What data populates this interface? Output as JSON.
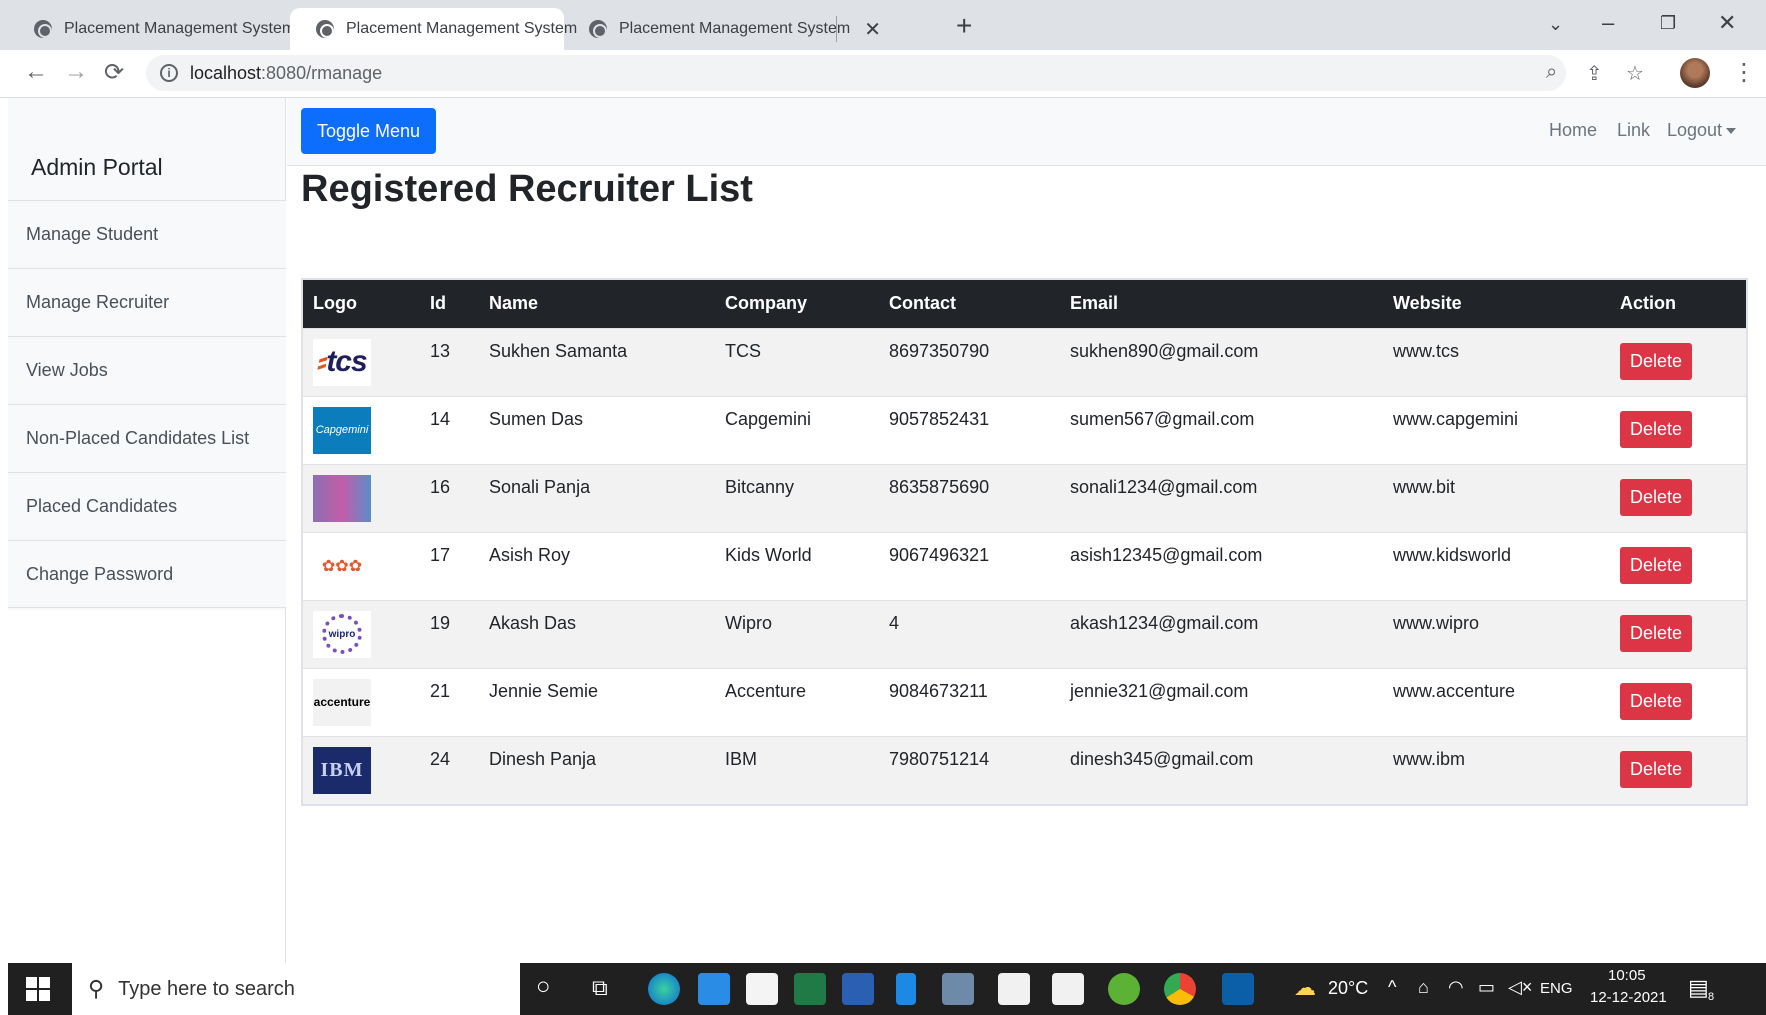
{
  "browser": {
    "tabs": [
      {
        "title": "Placement Management System",
        "close": "✕",
        "active": false
      },
      {
        "title": "Placement Management System",
        "close": "✕",
        "active": true
      },
      {
        "title": "Placement Management System",
        "close": "✕",
        "active": false
      }
    ],
    "new_tab": "+",
    "url_host": "localhost",
    "url_rest": ":8080/rmanage",
    "back": "←",
    "forward": "→",
    "reload": "⟳",
    "menu": "⋮"
  },
  "sidebar": {
    "brand": "Admin Portal",
    "items": [
      {
        "label": "Manage Student"
      },
      {
        "label": "Manage Recruiter"
      },
      {
        "label": "View Jobs"
      },
      {
        "label": "Non-Placed Candidates List"
      },
      {
        "label": "Placed Candidates"
      },
      {
        "label": "Change Password"
      }
    ]
  },
  "topnav": {
    "toggle_label": "Toggle Menu",
    "home": "Home",
    "link": "Link",
    "logout": "Logout"
  },
  "page": {
    "title": "Registered Recruiter List"
  },
  "table": {
    "headers": [
      "Logo",
      "Id",
      "Name",
      "Company",
      "Contact",
      "Email",
      "Website",
      "Action"
    ],
    "rows": [
      {
        "logo": "tcs-logo",
        "id": "13",
        "name": "Sukhen Samanta",
        "company": "TCS",
        "contact": "8697350790",
        "email": "sukhen890@gmail.com",
        "website": "www.tcs",
        "action": "Delete"
      },
      {
        "logo": "capgemini-logo",
        "id": "14",
        "name": "Sumen Das",
        "company": "Capgemini",
        "contact": "9057852431",
        "email": "sumen567@gmail.com",
        "website": "www.capgemini",
        "action": "Delete"
      },
      {
        "logo": "bitcanny-logo",
        "id": "16",
        "name": "Sonali Panja",
        "company": "Bitcanny",
        "contact": "8635875690",
        "email": "sonali1234@gmail.com",
        "website": "www.bit",
        "action": "Delete"
      },
      {
        "logo": "kids-world-logo",
        "id": "17",
        "name": "Asish Roy",
        "company": "Kids World",
        "contact": "9067496321",
        "email": "asish12345@gmail.com",
        "website": "www.kidsworld",
        "action": "Delete"
      },
      {
        "logo": "wipro-logo",
        "id": "19",
        "name": "Akash Das",
        "company": "Wipro",
        "contact": "4",
        "email": "akash1234@gmail.com",
        "website": "www.wipro",
        "action": "Delete"
      },
      {
        "logo": "accenture-logo",
        "id": "21",
        "name": "Jennie Semie",
        "company": "Accenture",
        "contact": "9084673211",
        "email": "jennie321@gmail.com",
        "website": "www.accenture",
        "action": "Delete"
      },
      {
        "logo": "ibm-logo",
        "id": "24",
        "name": "Dinesh Panja",
        "company": "IBM",
        "contact": "7980751214",
        "email": "dinesh345@gmail.com",
        "website": "www.ibm",
        "action": "Delete"
      }
    ]
  },
  "taskbar": {
    "search_placeholder": "Type here to search",
    "weather": "20°C",
    "language": "ENG",
    "time": "10:05",
    "date": "12-12-2021",
    "notifications": "8"
  },
  "colors": {
    "primary": "#0d6efd",
    "danger": "#dc3545",
    "table_header": "#212529"
  }
}
